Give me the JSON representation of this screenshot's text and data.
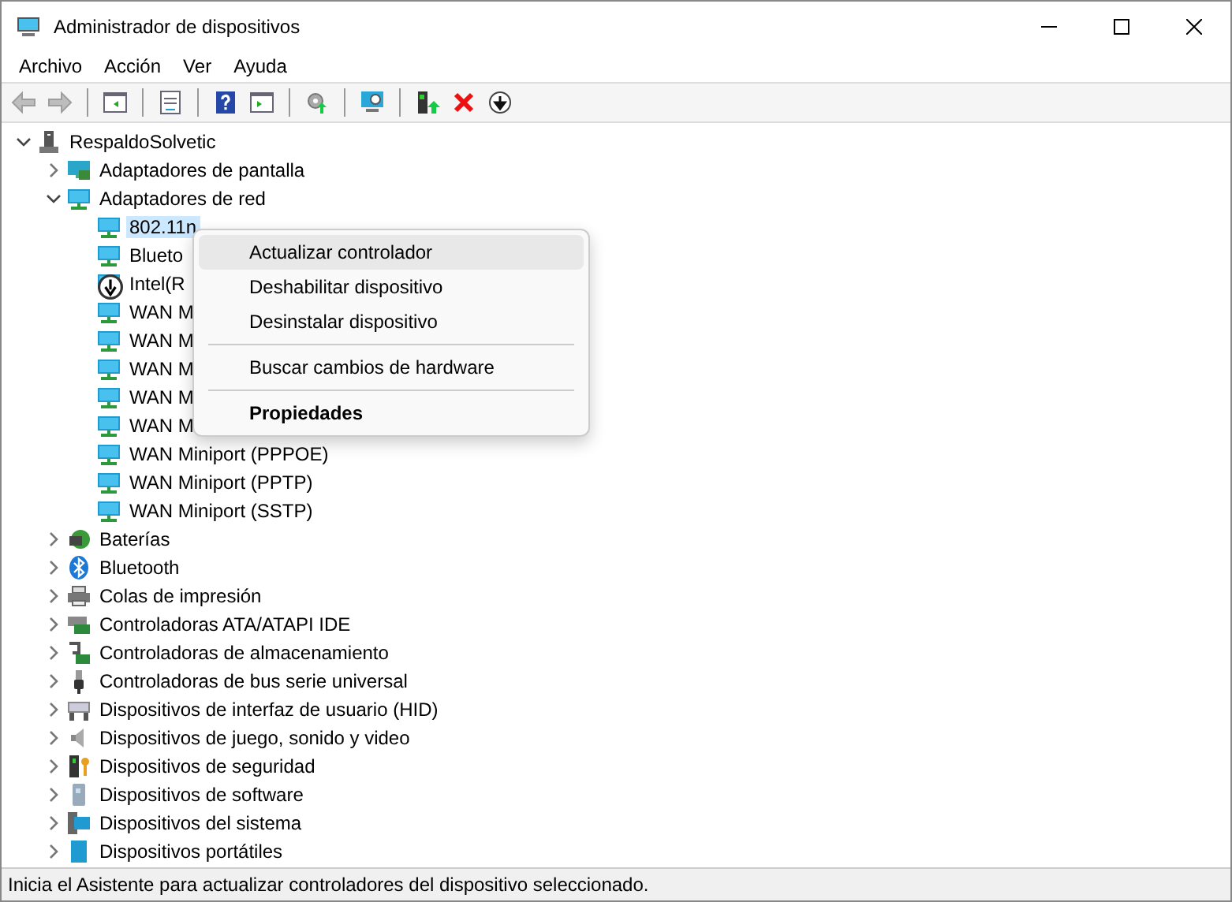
{
  "window": {
    "title": "Administrador de dispositivos"
  },
  "menu_bar": [
    "Archivo",
    "Acción",
    "Ver",
    "Ayuda"
  ],
  "toolbar": [
    {
      "kind": "back",
      "disabled": true
    },
    {
      "kind": "forward",
      "disabled": true
    },
    {
      "kind": "separator"
    },
    {
      "kind": "tree-pane"
    },
    {
      "kind": "separator"
    },
    {
      "kind": "properties"
    },
    {
      "kind": "separator"
    },
    {
      "kind": "help"
    },
    {
      "kind": "action-pane"
    },
    {
      "kind": "separator"
    },
    {
      "kind": "scan"
    },
    {
      "kind": "separator"
    },
    {
      "kind": "monitor"
    },
    {
      "kind": "separator"
    },
    {
      "kind": "update"
    },
    {
      "kind": "uninstall"
    },
    {
      "kind": "disable"
    }
  ],
  "tree": {
    "label": "RespaldoSolvetic",
    "kind": "computer",
    "expanded": true,
    "children": [
      {
        "label": "Adaptadores de pantalla",
        "kind": "display",
        "expanded": false
      },
      {
        "label": "Adaptadores de red",
        "kind": "network",
        "expanded": true,
        "children": [
          {
            "label": "802.11n",
            "kind": "network",
            "selected": true,
            "disabled": false
          },
          {
            "label": "Blueto",
            "kind": "network",
            "selected": false,
            "disabled": false
          },
          {
            "label": "Intel(R",
            "kind": "network",
            "selected": false,
            "disabled": true
          },
          {
            "label": "WAN M",
            "kind": "network",
            "selected": false,
            "disabled": false
          },
          {
            "label": "WAN M",
            "kind": "network",
            "selected": false,
            "disabled": false
          },
          {
            "label": "WAN M",
            "kind": "network",
            "selected": false,
            "disabled": false
          },
          {
            "label": "WAN M",
            "kind": "network",
            "selected": false,
            "disabled": false
          },
          {
            "label": "WAN M",
            "kind": "network",
            "selected": false,
            "disabled": false
          },
          {
            "label": "WAN Miniport (PPPOE)",
            "kind": "network",
            "selected": false,
            "disabled": false
          },
          {
            "label": "WAN Miniport (PPTP)",
            "kind": "network",
            "selected": false,
            "disabled": false
          },
          {
            "label": "WAN Miniport (SSTP)",
            "kind": "network",
            "selected": false,
            "disabled": false
          }
        ]
      },
      {
        "label": "Baterías",
        "kind": "battery",
        "expanded": false
      },
      {
        "label": "Bluetooth",
        "kind": "bluetooth",
        "expanded": false
      },
      {
        "label": "Colas de impresión",
        "kind": "printer",
        "expanded": false
      },
      {
        "label": "Controladoras ATA/ATAPI IDE",
        "kind": "controller",
        "expanded": false
      },
      {
        "label": "Controladoras de almacenamiento",
        "kind": "storage",
        "expanded": false
      },
      {
        "label": "Controladoras de bus serie universal",
        "kind": "usb",
        "expanded": false
      },
      {
        "label": "Dispositivos de interfaz de usuario (HID)",
        "kind": "hid",
        "expanded": false
      },
      {
        "label": "Dispositivos de juego, sonido y video",
        "kind": "sound",
        "expanded": false
      },
      {
        "label": "Dispositivos de seguridad",
        "kind": "security",
        "expanded": false
      },
      {
        "label": "Dispositivos de software",
        "kind": "software",
        "expanded": false
      },
      {
        "label": "Dispositivos del sistema",
        "kind": "system",
        "expanded": false
      },
      {
        "label": "Dispositivos portátiles",
        "kind": "portable",
        "expanded": false
      }
    ]
  },
  "context_menu": [
    {
      "kind": "item",
      "label": "Actualizar controlador",
      "selected": true
    },
    {
      "kind": "item",
      "label": "Deshabilitar dispositivo",
      "selected": false
    },
    {
      "kind": "item",
      "label": "Desinstalar dispositivo",
      "selected": false
    },
    {
      "kind": "separator"
    },
    {
      "kind": "item",
      "label": "Buscar cambios de hardware",
      "selected": false
    },
    {
      "kind": "separator"
    },
    {
      "kind": "default",
      "label": "Propiedades",
      "selected": false
    }
  ],
  "status_bar": "Inicia el Asistente para actualizar controladores del dispositivo seleccionado."
}
